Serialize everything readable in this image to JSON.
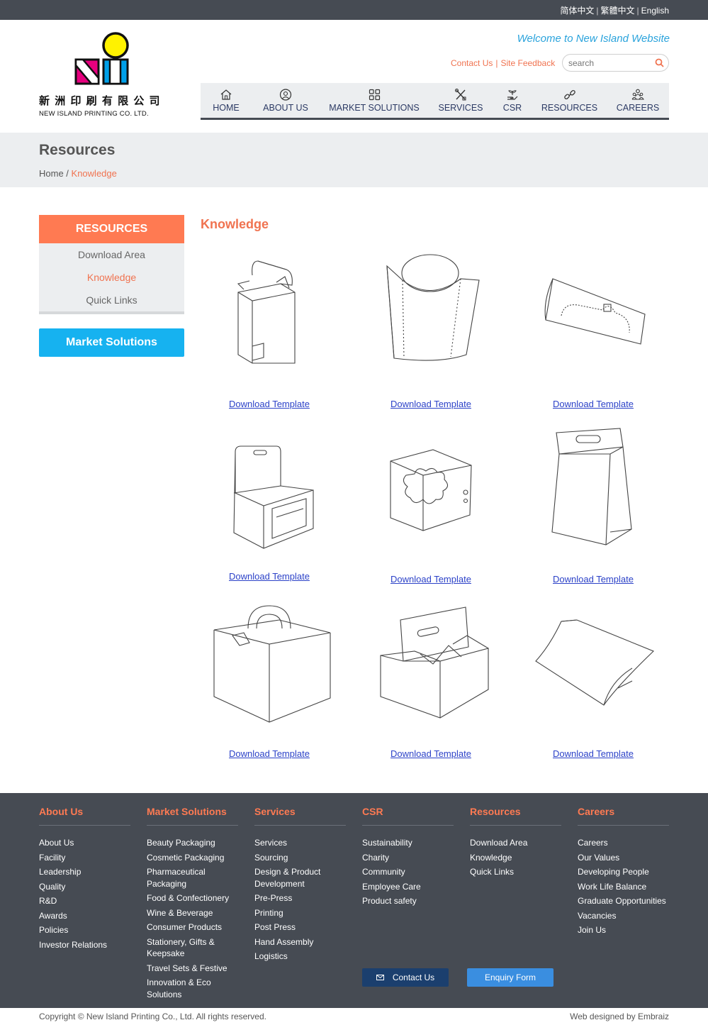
{
  "languages": [
    "简体中文",
    "繁體中文",
    "English"
  ],
  "brand": {
    "name_zh": "新 洲 印 刷 有 限 公 司",
    "name_en": "NEW ISLAND PRINTING CO. LTD."
  },
  "header": {
    "welcome": "Welcome to New Island Website",
    "contact_link": "Contact Us",
    "feedback_link": "Site Feedback",
    "search_placeholder": "search"
  },
  "nav": [
    {
      "label": "HOME",
      "icon": "home-icon"
    },
    {
      "label": "ABOUT US",
      "icon": "user-circle-icon"
    },
    {
      "label": "MARKET SOLUTIONS",
      "icon": "grid-icon"
    },
    {
      "label": "SERVICES",
      "icon": "tools-icon"
    },
    {
      "label": "CSR",
      "icon": "hand-plant-icon"
    },
    {
      "label": "RESOURCES",
      "icon": "link-icon"
    },
    {
      "label": "CAREERS",
      "icon": "people-icon"
    }
  ],
  "page": {
    "title": "Resources",
    "breadcrumb_home": "Home",
    "breadcrumb_sep": " / ",
    "breadcrumb_current": "Knowledge",
    "section_title": "Knowledge"
  },
  "sidebar": {
    "heading": "RESOURCES",
    "items": [
      {
        "label": "Download Area",
        "active": false
      },
      {
        "label": "Knowledge",
        "active": true
      },
      {
        "label": "Quick Links",
        "active": false
      }
    ],
    "market_button": "Market Solutions"
  },
  "templates": [
    {
      "icon": "tuck-box-icon",
      "link": "Download Template"
    },
    {
      "icon": "fries-box-icon",
      "link": "Download Template"
    },
    {
      "icon": "pillow-sleeve-icon",
      "link": "Download Template"
    },
    {
      "icon": "window-display-box-icon",
      "link": "Download Template"
    },
    {
      "icon": "cupcake-insert-box-icon",
      "link": "Download Template"
    },
    {
      "icon": "handle-bag-box-icon",
      "link": "Download Template"
    },
    {
      "icon": "cake-box-with-handle-icon",
      "link": "Download Template"
    },
    {
      "icon": "bottle-carrier-icon",
      "link": "Download Template"
    },
    {
      "icon": "pillow-box-icon",
      "link": "Download Template"
    }
  ],
  "footer": {
    "columns": [
      {
        "title": "About Us",
        "items": [
          "About Us",
          "Facility",
          "Leadership",
          "Quality",
          "R&D",
          "Awards",
          "Policies",
          "Investor Relations"
        ]
      },
      {
        "title": "Market Solutions",
        "items": [
          "Beauty Packaging",
          "Cosmetic Packaging",
          "Pharmaceutical Packaging",
          "Food & Confectionery",
          "Wine & Beverage",
          "Consumer Products",
          "Stationery, Gifts & Keepsake",
          "Travel Sets & Festive",
          "Innovation & Eco Solutions"
        ]
      },
      {
        "title": "Services",
        "items": [
          "Services",
          "Sourcing",
          "Design & Product Development",
          "Pre-Press",
          "Printing",
          "Post Press",
          "Hand Assembly",
          "Logistics"
        ]
      },
      {
        "title": "CSR",
        "items": [
          "Sustainability",
          "Charity",
          "Community",
          "Employee Care",
          "Product safety"
        ]
      },
      {
        "title": "Resources",
        "items": [
          "Download Area",
          "Knowledge",
          "Quick Links"
        ]
      },
      {
        "title": "Careers",
        "items": [
          "Careers",
          "Our Values",
          "Developing People",
          "Work Life Balance",
          "Graduate Opportunities",
          "Vacancies",
          "Join Us"
        ]
      }
    ],
    "contact_button": "Contact Us",
    "enquiry_button": "Enquiry Form",
    "copyright": "Copyright © New Island Printing Co., Ltd. All rights reserved.",
    "credit": "Web designed by Embraiz"
  },
  "colors": {
    "accent_orange": "#ff7a52",
    "accent_blue": "#16b2f0",
    "dark": "#464b53",
    "link_blue": "#2c42c8"
  }
}
